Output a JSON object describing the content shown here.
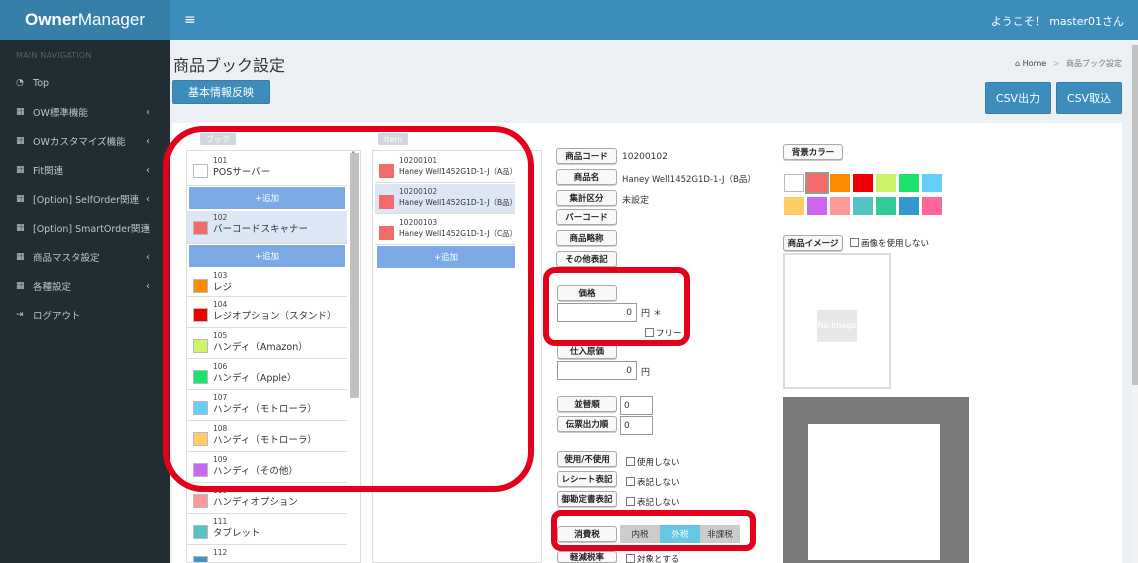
{
  "app": {
    "logo_bold": "Owner",
    "logo_rest": "Manager",
    "welcome": "ようこそ！ master01さん"
  },
  "sidebar": {
    "header": "MAIN NAVIGATION",
    "items": [
      {
        "icon": "dashboard-icon",
        "label": "Top",
        "chevron": false
      },
      {
        "icon": "grid-icon",
        "label": "OW標準機能",
        "chevron": true
      },
      {
        "icon": "grid-icon",
        "label": "OWカスタマイズ機能",
        "chevron": true
      },
      {
        "icon": "grid-icon",
        "label": "Fit関連",
        "chevron": true
      },
      {
        "icon": "grid-icon",
        "label": "[Option] SelfOrder関連",
        "chevron": true
      },
      {
        "icon": "grid-icon",
        "label": "[Option] SmartOrder関連",
        "chevron": true
      },
      {
        "icon": "grid-icon",
        "label": "商品マスタ設定",
        "chevron": true
      },
      {
        "icon": "grid-icon",
        "label": "各種設定",
        "chevron": true
      },
      {
        "icon": "logout-icon",
        "label": "ログアウト",
        "chevron": false
      }
    ]
  },
  "page": {
    "title": "商品ブック設定",
    "breadcrumb_home": "Home",
    "breadcrumb_current": "商品ブック設定",
    "reflect_button": "基本情報反映",
    "csv_out": "CSV出力",
    "csv_in": "CSV取込"
  },
  "folders": {
    "header": "ブック",
    "add_label": "+追加",
    "items": [
      {
        "code": "101",
        "name": "POSサーバー",
        "color": "#ffffff"
      },
      {
        "code": "102",
        "name": "バーコードスキャナー",
        "color": "#f26b6b"
      },
      {
        "code": "103",
        "name": "レジ",
        "color": "#fb8c00"
      },
      {
        "code": "104",
        "name": "レジオプション（スタンド）",
        "color": "#ee0000"
      },
      {
        "code": "105",
        "name": "ハンディ（Amazon）",
        "color": "#ccf36a"
      },
      {
        "code": "106",
        "name": "ハンディ（Apple）",
        "color": "#1de36c"
      },
      {
        "code": "107",
        "name": "ハンディ（モトローラ）",
        "color": "#66ccf9"
      },
      {
        "code": "108",
        "name": "ハンディ（モトローラ）",
        "color": "#ffcc66"
      },
      {
        "code": "109",
        "name": "ハンディ（その他）",
        "color": "#cc66ee"
      },
      {
        "code": "110",
        "name": "ハンディオプション",
        "color": "#ff9999"
      },
      {
        "code": "111",
        "name": "タブレット",
        "color": "#55c3c3"
      },
      {
        "code": "112",
        "name": "",
        "color": "#3399cc"
      }
    ]
  },
  "items": {
    "header": "Item",
    "add_label": "+追加",
    "list": [
      {
        "code": "10200101",
        "name": "Haney Well1452G1D-1-J（A品）"
      },
      {
        "code": "10200102",
        "name": "Haney Well1452G1D-1-J（B品）"
      },
      {
        "code": "10200103",
        "name": "Haney Well1452G1D-1-J（C品）"
      }
    ]
  },
  "detail": {
    "product_code_label": "商品コード",
    "product_code": "10200102",
    "product_name_label": "商品名",
    "product_name": "Haney Well1452G1D-1-J（B品）",
    "category_label": "集計区分",
    "category": "未設定",
    "barcode_label": "バーコード",
    "short_name_label": "商品略称",
    "other_label": "その他表記",
    "price_label": "価格",
    "price": "0",
    "yen": "円",
    "required": "＊",
    "free_label": "フリー",
    "cost_label": "仕入原価",
    "cost": "0",
    "sort_label": "並替順",
    "sort": "0",
    "slip_label": "伝票出力順",
    "slip": "0",
    "use_label": "使用/不使用",
    "use_cb": "使用しない",
    "receipt_label": "レシート表記",
    "receipt_cb": "表記しない",
    "invoice_label": "御勘定書表記",
    "invoice_cb": "表記しない",
    "tax_label": "消費税",
    "tax_options": [
      "内税",
      "外税",
      "非課税"
    ],
    "tax_active": 1,
    "reduced_label": "軽減税率",
    "reduced_cb": "対象とする"
  },
  "appearance": {
    "bg_color_label": "背景カラー",
    "image_label": "商品イメージ",
    "no_image_cb": "画像を使用しない",
    "no_image_text": "No Image",
    "palette": [
      "#ffffff",
      "#f26b6b",
      "#fb8c00",
      "#ee0000",
      "#ccf36a",
      "#1de36c",
      "#66ccf9",
      "#ffcc66",
      "#cc66ee",
      "#ff9999",
      "#55c3c3",
      "#33cc99",
      "#3399cc",
      "#ff6699"
    ]
  }
}
